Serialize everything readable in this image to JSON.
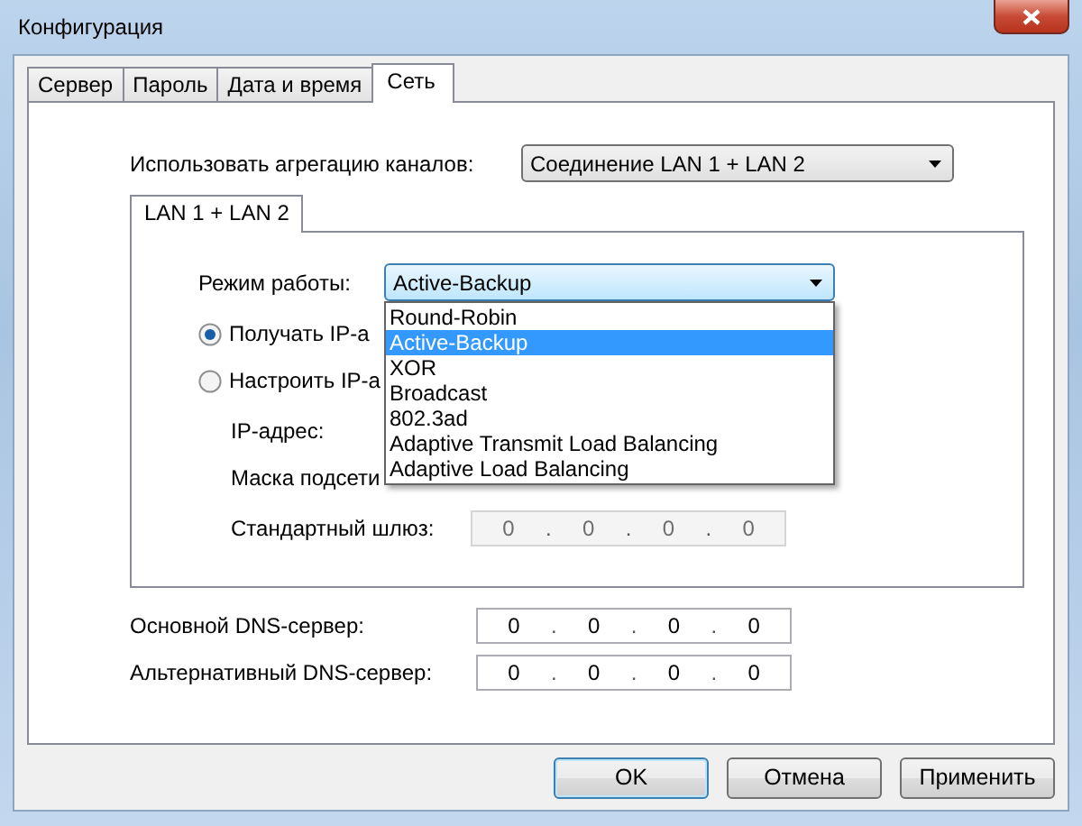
{
  "window": {
    "title": "Конфигурация"
  },
  "tabs": [
    {
      "label": "Сервер",
      "selected": false
    },
    {
      "label": "Пароль",
      "selected": false
    },
    {
      "label": "Дата и время",
      "selected": false
    },
    {
      "label": "Сеть",
      "selected": true
    }
  ],
  "aggregation": {
    "label": "Использовать агрегацию каналов:",
    "value": "Соединение LAN 1 + LAN 2"
  },
  "inner_tabs": [
    {
      "label": "LAN 1 + LAN 2",
      "selected": true
    }
  ],
  "mode": {
    "label": "Режим работы:",
    "value": "Active-Backup",
    "expanded": true,
    "options": [
      {
        "label": "Round-Robin",
        "selected": false
      },
      {
        "label": "Active-Backup",
        "selected": true
      },
      {
        "label": "XOR",
        "selected": false
      },
      {
        "label": "Broadcast",
        "selected": false
      },
      {
        "label": "802.3ad",
        "selected": false
      },
      {
        "label": "Adaptive Transmit Load Balancing",
        "selected": false
      },
      {
        "label": "Adaptive Load Balancing",
        "selected": false
      }
    ]
  },
  "ip_options": [
    {
      "label": "Получать IP-а",
      "selected": true
    },
    {
      "label": "Настроить IP-а",
      "selected": false
    }
  ],
  "ip_fields": [
    {
      "label": "IP-адрес:"
    },
    {
      "label": "Маска подсети"
    },
    {
      "label": "Стандартный шлюз:",
      "octets": [
        "0",
        "0",
        "0",
        "0"
      ],
      "separator": ".",
      "disabled": true
    }
  ],
  "dns_fields": [
    {
      "label": "Основной DNS-сервер:",
      "octets": [
        "0",
        "0",
        "0",
        "0"
      ],
      "separator": ".",
      "disabled": false
    },
    {
      "label": "Альтернативный DNS-сервер:",
      "octets": [
        "0",
        "0",
        "0",
        "0"
      ],
      "separator": ".",
      "disabled": false
    }
  ],
  "buttons": [
    {
      "label": "OK",
      "default": true
    },
    {
      "label": "Отмена",
      "default": false
    },
    {
      "label": "Применить",
      "default": false
    }
  ]
}
